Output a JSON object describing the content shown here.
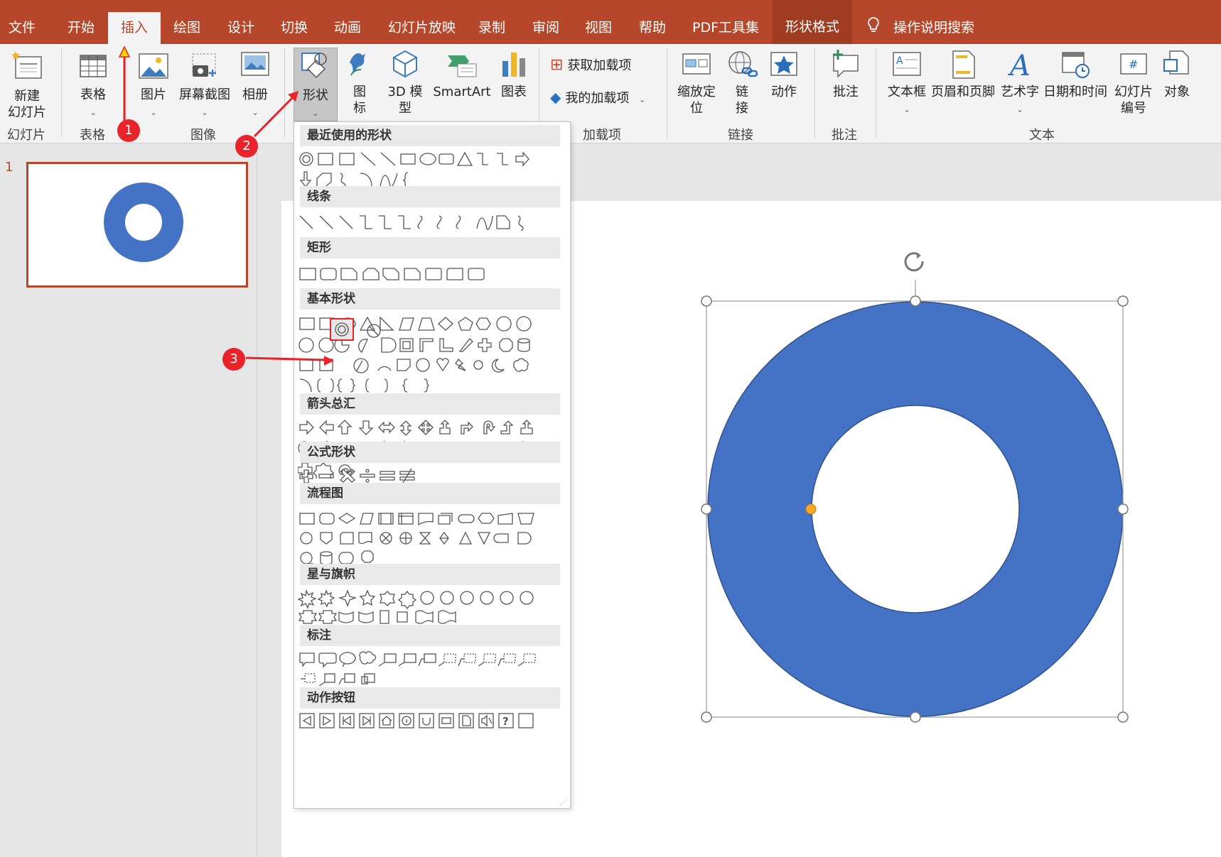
{
  "menu": {
    "items": [
      "文件",
      "开始",
      "插入",
      "绘图",
      "设计",
      "切换",
      "动画",
      "幻灯片放映",
      "录制",
      "审阅",
      "视图",
      "帮助",
      "PDF工具集",
      "形状格式"
    ],
    "active": "插入",
    "search_label": "操作说明搜索"
  },
  "ribbon": {
    "new_slide": "新建\n幻灯片",
    "table": "表格",
    "picture": "图片",
    "screenshot": "屏幕截图",
    "album": "相册",
    "shapes": "形状",
    "icons": "图\n标",
    "model3d": "3D 模\n型",
    "smartart": "SmartArt",
    "chart": "图表",
    "get_addins": "获取加载项",
    "my_addins": "我的加载项",
    "zoom": "缩放定\n位",
    "link": "链\n接",
    "action": "动作",
    "comment": "批注",
    "textbox": "文本框",
    "header_footer": "页眉和页脚",
    "wordart": "艺术字",
    "datetime": "日期和时间",
    "slide_number": "幻灯片\n编号",
    "object": "对象",
    "groups": {
      "slides": "幻灯片",
      "tables": "表格",
      "images": "图像",
      "addins": "加载项",
      "links": "链接",
      "comments": "批注",
      "text": "文本"
    }
  },
  "thumbnails": {
    "slide_number": "1"
  },
  "shapes_menu": {
    "sections": [
      "最近使用的形状",
      "线条",
      "矩形",
      "基本形状",
      "箭头总汇",
      "公式形状",
      "流程图",
      "星与旗帜",
      "标注",
      "动作按钮"
    ]
  },
  "annotations": [
    "1",
    "2",
    "3"
  ],
  "colors": {
    "accent": "#b7472a",
    "shape_fill": "#4472c4",
    "annotation": "#e8232a",
    "handle_adjust": "#f5a623"
  }
}
